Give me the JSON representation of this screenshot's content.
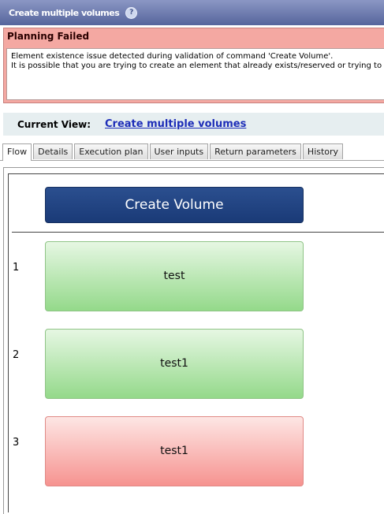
{
  "window": {
    "title": "Create multiple volumes",
    "help_icon": "?"
  },
  "error": {
    "title": "Planning Failed",
    "line1": "Element existence issue detected during validation of command 'Create Volume'.",
    "line2": "It is possible that you are trying to create an element that already exists/reserved or trying to rem"
  },
  "current_view": {
    "label": "Current View:",
    "link": "Create multiple volumes"
  },
  "tabs": [
    {
      "label": "Flow",
      "active": true
    },
    {
      "label": "Details"
    },
    {
      "label": "Execution plan"
    },
    {
      "label": "User inputs"
    },
    {
      "label": "Return parameters"
    },
    {
      "label": "History"
    }
  ],
  "flow": {
    "command": "Create Volume",
    "rows": [
      {
        "num": "1",
        "label": "test",
        "status": "success"
      },
      {
        "num": "2",
        "label": "test1",
        "status": "success"
      },
      {
        "num": "3",
        "label": "test1",
        "status": "failed"
      }
    ]
  },
  "colors": {
    "success": "#94d98a",
    "failed": "#f69390",
    "header": "#1a3a77",
    "error_panel": "#f4a8a2"
  }
}
